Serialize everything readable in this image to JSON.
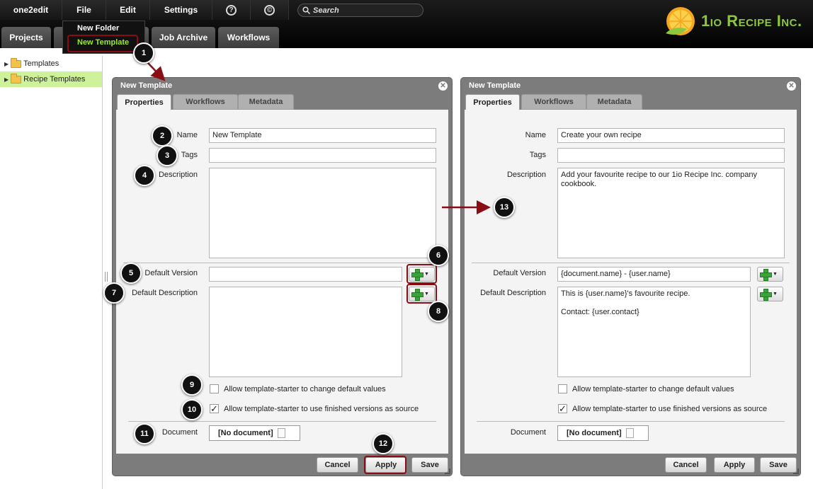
{
  "menu": {
    "app": "one2edit",
    "file": "File",
    "edit": "Edit",
    "settings": "Settings",
    "help_icon": "?",
    "copyright_icon": "©",
    "search_placeholder": "Search"
  },
  "logo": {
    "text": "1io Recipe Inc."
  },
  "tabs": {
    "projects": "Projects",
    "job_archive": "Job Archive",
    "workflows": "Workflows"
  },
  "file_menu": {
    "new_folder": "New Folder",
    "new_template": "New Template"
  },
  "tree": [
    {
      "label": "Templates"
    },
    {
      "label": "Recipe Templates"
    }
  ],
  "dialog_left": {
    "title": "New Template",
    "tabs": [
      "Properties",
      "Workflows",
      "Metadata"
    ],
    "name_label": "Name",
    "name_value": "New Template",
    "tags_label": "Tags",
    "tags_value": "",
    "description_label": "Description",
    "description_value": "",
    "default_version_label": "Default Version",
    "default_version_value": "",
    "default_description_label": "Default Description",
    "default_description_value": "",
    "check1_label": "Allow template-starter to change default values",
    "check1_checked": "",
    "check2_label": "Allow template-starter to use finished versions as source",
    "check2_checked": "✓",
    "document_label": "Document",
    "document_value": "[No document]",
    "cancel": "Cancel",
    "apply": "Apply",
    "save": "Save"
  },
  "dialog_right": {
    "title": "New Template",
    "tabs": [
      "Properties",
      "Workflows",
      "Metadata"
    ],
    "name_label": "Name",
    "name_value": "Create your own recipe",
    "tags_label": "Tags",
    "tags_value": "",
    "description_label": "Description",
    "description_value": "Add your favourite recipe to our 1io Recipe Inc. company cookbook.",
    "default_version_label": "Default Version",
    "default_version_value": "{document.name} - {user.name}",
    "default_description_label": "Default Description",
    "default_description_value": "This is {user.name}'s favourite recipe.\n\nContact: {user.contact}",
    "check1_label": "Allow template-starter to change default values",
    "check1_checked": "",
    "check2_label": "Allow template-starter to use finished versions as source",
    "check2_checked": "✓",
    "document_label": "Document",
    "document_value": "[No document]",
    "cancel": "Cancel",
    "apply": "Apply",
    "save": "Save"
  },
  "badges": [
    "1",
    "2",
    "3",
    "4",
    "5",
    "6",
    "7",
    "8",
    "9",
    "10",
    "11",
    "12",
    "13"
  ],
  "colors": {
    "accent": "#8dc63f",
    "highlight": "#8b0d14",
    "selected": "#cdf29a"
  }
}
